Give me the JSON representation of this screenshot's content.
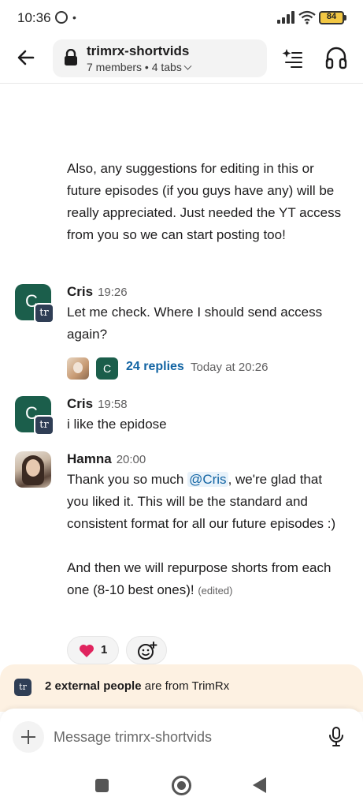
{
  "status_bar": {
    "time": "10:36",
    "dot": "•",
    "battery": "84"
  },
  "header": {
    "channel_name": "trimrx-shortvids",
    "channel_meta": "7 members • 4 tabs"
  },
  "messages": {
    "continuation_text": "Also, any suggestions for editing in this or future episodes (if you guys have any) will be really appreciated. Just needed the YT access from you so we can start posting too!",
    "m1": {
      "author": "Cris",
      "time": "19:26",
      "avatar_letter": "C",
      "badge": "tr",
      "text": "Let me check. Where I should send access again?",
      "thread": {
        "avatar_letter": "C",
        "replies": "24 replies",
        "last_reply": "Today at 20:26"
      }
    },
    "m2": {
      "author": "Cris",
      "time": "19:58",
      "avatar_letter": "C",
      "badge": "tr",
      "text": "i like the epidose"
    },
    "m3": {
      "author": "Hamna",
      "time": "20:00",
      "text_before_mention": "Thank you so much ",
      "mention": "@Cris",
      "text_after_mention": ", we're glad that you liked it. This will be the standard and consistent format for all our future episodes :)",
      "text_para2": "And then we will repurpose shorts from each one (8-10 best ones)!",
      "edited": "(edited)",
      "reaction": {
        "emoji": "heart",
        "count": "1"
      }
    }
  },
  "banner": {
    "logo": "tr",
    "bold": "2 external people",
    "rest": " are from TrimRx"
  },
  "composer": {
    "placeholder": "Message trimrx-shortvids"
  },
  "colors": {
    "accent_link": "#1264a3",
    "avatar_green": "#1b5e4b",
    "banner_bg": "#fdf1e2"
  }
}
